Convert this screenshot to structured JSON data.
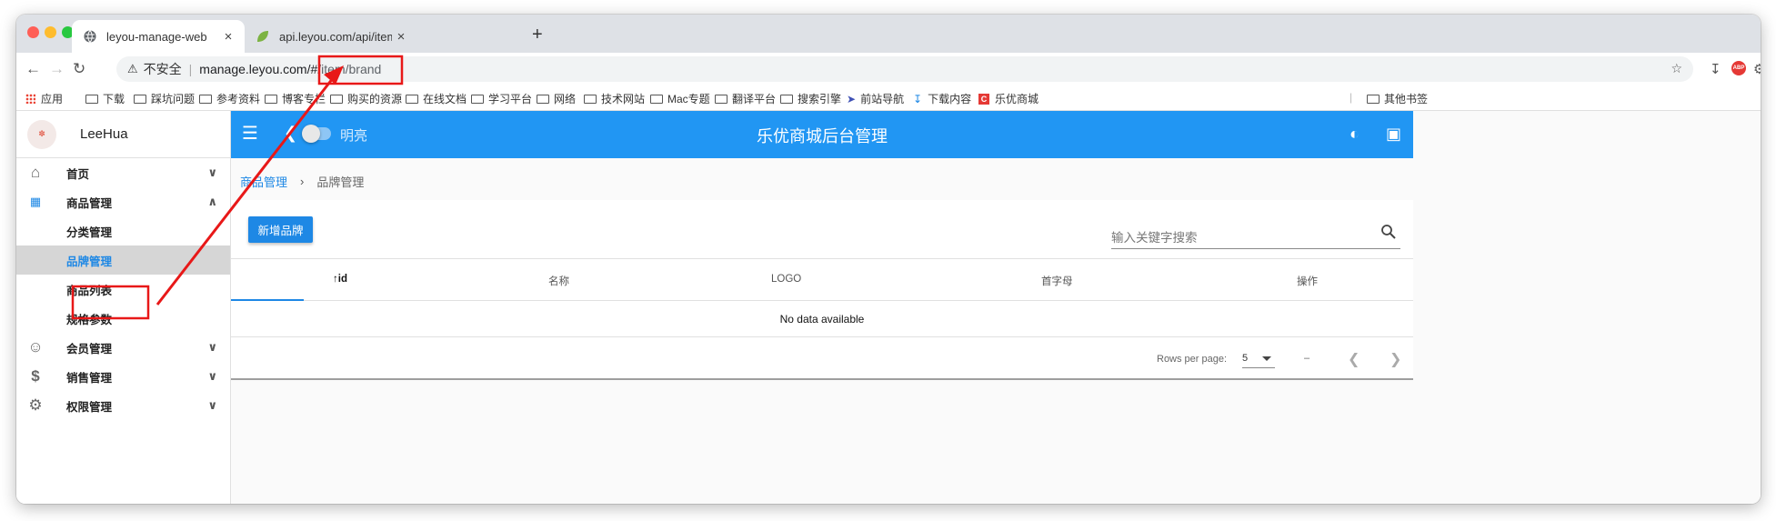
{
  "browser": {
    "tabs": [
      {
        "title": "leyou-manage-web",
        "close": "×"
      },
      {
        "title": "api.leyou.com/api/item/category",
        "close": "×"
      }
    ],
    "new_tab": "+",
    "url_warning": "不安全",
    "url_host": "manage.leyou.com/#",
    "url_path": "/item/brand"
  },
  "bookmarks": [
    "应用",
    "下载",
    "踩坑问题",
    "参考资料",
    "博客专栏",
    "购买的资源",
    "在线文档",
    "学习平台",
    "网络",
    "技术网站",
    "Mac专题",
    "翻译平台",
    "搜索引擎",
    "前站导航",
    "下载内容",
    "乐优商城",
    "其他书签"
  ],
  "sidebar": {
    "user": "LeeHua",
    "items": [
      {
        "label": "首页"
      },
      {
        "label": "商品管理"
      },
      {
        "label": "分类管理"
      },
      {
        "label": "品牌管理"
      },
      {
        "label": "商品列表"
      },
      {
        "label": "规格参数"
      },
      {
        "label": "会员管理"
      },
      {
        "label": "销售管理"
      },
      {
        "label": "权限管理"
      }
    ]
  },
  "appbar": {
    "theme_label": "明亮",
    "title": "乐优商城后台管理"
  },
  "breadcrumb": {
    "parent": "商品管理",
    "current": "品牌管理"
  },
  "toolbar": {
    "add_label": "新增品牌",
    "search_placeholder": "输入关键字搜索"
  },
  "table": {
    "headers": [
      "id",
      "名称",
      "LOGO",
      "首字母",
      "操作"
    ],
    "empty_text": "No data available",
    "rows_per_page_label": "Rows per page:",
    "rows_per_page": "5",
    "range": "–"
  },
  "colors": {
    "primary": "#2196f3",
    "link": "#1e88e5",
    "annotation": "#e81818"
  }
}
